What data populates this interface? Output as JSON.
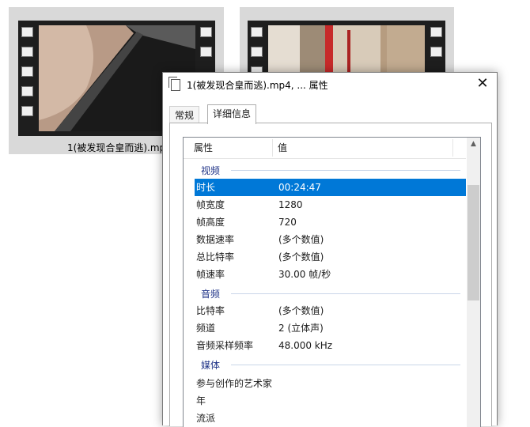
{
  "thumbnails": [
    {
      "caption": "1(被发现合皇而逃).mp"
    },
    {
      "caption": ""
    }
  ],
  "dialog": {
    "title": "1(被发现合皇而逃).mp4, ... 属性",
    "close_glyph": "✕",
    "tabs": [
      {
        "label": "常规"
      },
      {
        "label": "详细信息"
      }
    ],
    "columns": {
      "property": "属性",
      "value": "值"
    },
    "groups": [
      {
        "label": "视频"
      },
      {
        "label": "音频"
      },
      {
        "label": "媒体"
      }
    ],
    "video_rows": [
      {
        "key": "时长",
        "value": "00:24:47"
      },
      {
        "key": "帧宽度",
        "value": "1280"
      },
      {
        "key": "帧高度",
        "value": "720"
      },
      {
        "key": "数据速率",
        "value": "(多个数值)"
      },
      {
        "key": "总比特率",
        "value": "(多个数值)"
      },
      {
        "key": "帧速率",
        "value": "30.00 帧/秒"
      }
    ],
    "audio_rows": [
      {
        "key": "比特率",
        "value": "(多个数值)"
      },
      {
        "key": "频道",
        "value": "2 (立体声)"
      },
      {
        "key": "音频采样频率",
        "value": "48.000 kHz"
      }
    ],
    "media_rows": [
      {
        "key": "参与创作的艺术家",
        "value": ""
      },
      {
        "key": "年",
        "value": ""
      },
      {
        "key": "流派",
        "value": ""
      }
    ],
    "scroll_up_glyph": "▲"
  },
  "colors": {
    "selection": "#0078d7",
    "group_label": "#1e3287"
  }
}
